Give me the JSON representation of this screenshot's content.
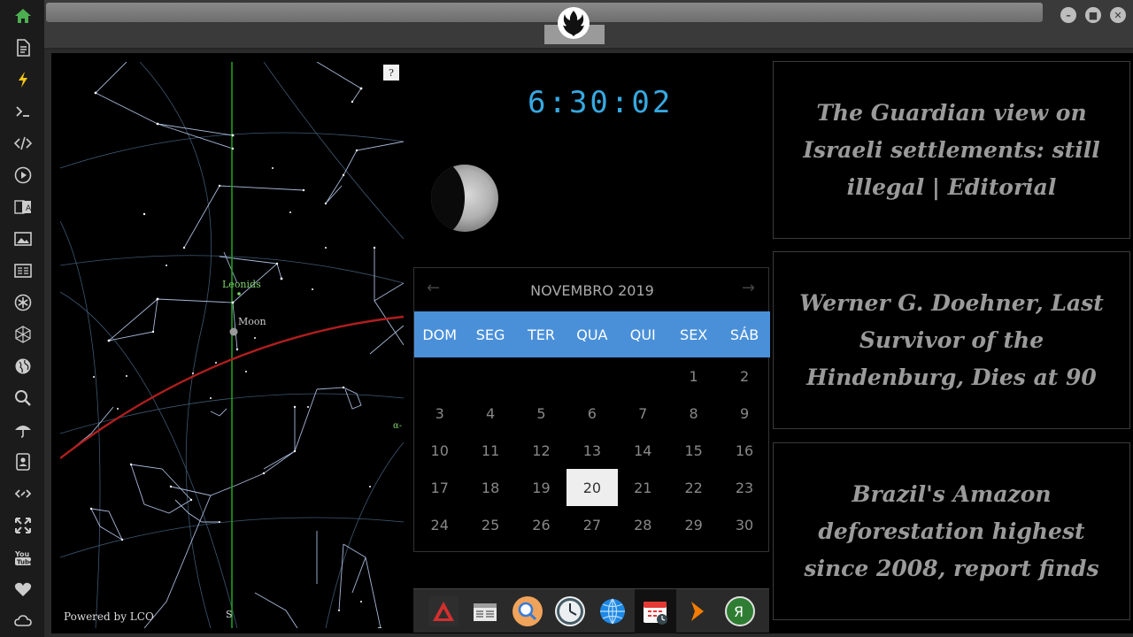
{
  "sidebar": {
    "icons": [
      "home-icon",
      "document-icon",
      "lightning-icon",
      "terminal-icon",
      "code-icon",
      "play-icon",
      "translate-icon",
      "image-icon",
      "news-icon",
      "settings-icon",
      "network-icon",
      "globe-icon",
      "search-icon",
      "umbrella-icon",
      "contacts-icon",
      "link-icon",
      "expand-icon",
      "youtube-icon",
      "heart-icon",
      "cloud-icon"
    ]
  },
  "skymap": {
    "help": "?",
    "powered_by": "Powered by LCO",
    "south": "S",
    "leonids": "Leonids",
    "moon": "Moon",
    "alpha": "α-"
  },
  "clock": {
    "time": "6:30:02"
  },
  "calendar": {
    "prev": "←",
    "next": "→",
    "title": "NOVEMBRO 2019",
    "weekdays": [
      "DOM",
      "SEG",
      "TER",
      "QUA",
      "QUI",
      "SEX",
      "SÁB"
    ],
    "days": [
      "",
      "",
      "",
      "",
      "",
      "1",
      "2",
      "3",
      "4",
      "5",
      "6",
      "7",
      "8",
      "9",
      "10",
      "11",
      "12",
      "13",
      "14",
      "15",
      "16",
      "17",
      "18",
      "19",
      "20",
      "21",
      "22",
      "23",
      "24",
      "25",
      "26",
      "27",
      "28",
      "29",
      "30"
    ],
    "today": "20"
  },
  "dock": {
    "icons": [
      "red-triangle-app-icon",
      "newspaper-app-icon",
      "search-app-icon",
      "clock-app-icon",
      "globe-app-icon",
      "calendar-app-icon",
      "arrow-app-icon",
      "yandex-app-icon"
    ]
  },
  "news": [
    {
      "headline": "The Guardian view on Israeli settlements: still illegal | Editorial"
    },
    {
      "headline": "Werner G. Doehner, Last Survivor of the Hindenburg, Dies at 90"
    },
    {
      "headline": "Brazil's Amazon deforestation highest since 2008, report finds"
    }
  ],
  "colors": {
    "accent": "#4a90d9",
    "clock": "#36a9e1",
    "ecliptic": "#b01e1e",
    "meridian": "#1e9e1e"
  }
}
